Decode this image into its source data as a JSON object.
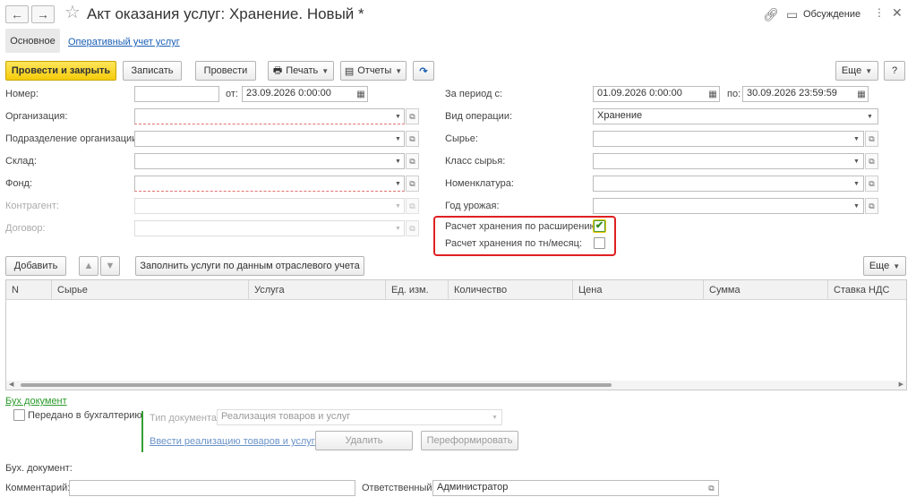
{
  "window": {
    "title": "Акт оказания услуг: Хранение. Новый *",
    "back_icon": "←",
    "forward_icon": "→",
    "discussion_label": "Обсуждение"
  },
  "tabs": {
    "main": "Основное",
    "operational": "Оперативный учет услуг"
  },
  "toolbar": {
    "post_close": "Провести и закрыть",
    "save": "Записать",
    "post": "Провести",
    "print": "Печать",
    "reports": "Отчеты",
    "more": "Еще",
    "help": "?"
  },
  "left_fields": {
    "number_label": "Номер:",
    "number_value": "",
    "date_from_label": "от:",
    "date_from_value": "23.09.2026  0:00:00",
    "organization_label": "Организация:",
    "organization_value": "",
    "subdivision_label": "Подразделение организации:",
    "subdivision_value": "",
    "warehouse_label": "Склад:",
    "warehouse_value": "",
    "fund_label": "Фонд:",
    "fund_value": "",
    "counterparty_label": "Контрагент:",
    "counterparty_value": "",
    "contract_label": "Договор:",
    "contract_value": ""
  },
  "right_fields": {
    "period_label": "За период с:",
    "period_from_value": "01.09.2026  0:00:00",
    "period_to_label": "по:",
    "period_to_value": "30.09.2026 23:59:59",
    "operation_label": "Вид операции:",
    "operation_value": "Хранение",
    "raw_label": "Сырье:",
    "raw_value": "",
    "raw_class_label": "Класс сырья:",
    "raw_class_value": "",
    "nomenclature_label": "Номенклатура:",
    "nomenclature_value": "",
    "harvest_year_label": "Год урожая:",
    "harvest_year_value": ""
  },
  "storage_calc": {
    "by_extension_label": "Расчет хранения по расширению:",
    "by_extension_checked": true,
    "by_ton_month_label": "Расчет хранения по тн/месяц:",
    "by_ton_month_checked": false
  },
  "table_toolbar": {
    "add": "Добавить",
    "fill": "Заполнить услуги по данным отраслевого учета",
    "more": "Еще"
  },
  "table": {
    "columns": [
      "N",
      "Сырье",
      "Услуга",
      "Ед. изм.",
      "Количество",
      "Цена",
      "Сумма",
      "Ставка НДС"
    ],
    "rows": []
  },
  "accounting": {
    "section_link": "Бух документ",
    "transferred_label": "Передано в бухгалтерию",
    "transferred_checked": false,
    "doc_type_label": "Тип документа:",
    "doc_type_value": "Реализация товаров и услуг",
    "enter_link": "Ввести реализацию товаров и услуг",
    "delete": "Удалить",
    "reform": "Переформировать",
    "acc_doc_label": "Бух. документ:"
  },
  "footer": {
    "comment_label": "Комментарий:",
    "comment_value": "",
    "responsible_label": "Ответственный:",
    "responsible_value": "Администратор"
  },
  "colors": {
    "accent_yellow": "#f5cc0b",
    "link_blue": "#1a5fb4",
    "highlight_red": "#e02020",
    "check_green": "#2e8a1a"
  }
}
